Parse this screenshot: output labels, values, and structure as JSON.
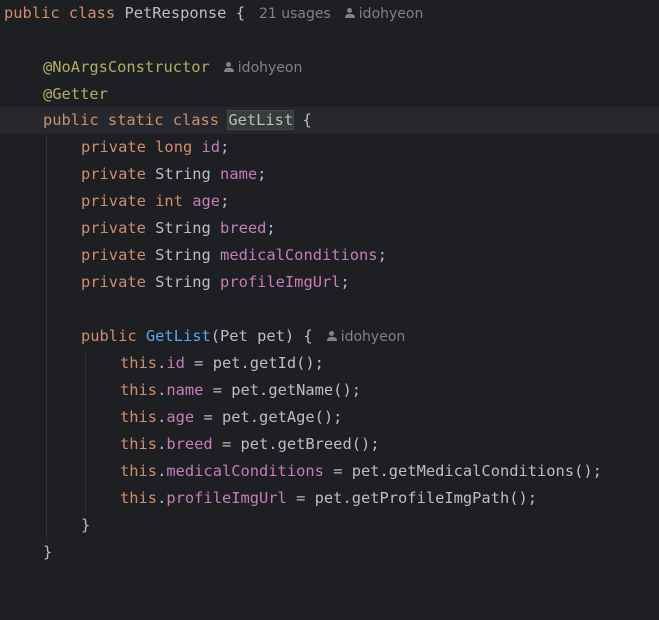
{
  "code": {
    "outer_class": {
      "modifiers": "public class",
      "name": "PetResponse",
      "brace": "{",
      "usages_hint": "21 usages",
      "author": "idohyeon"
    },
    "annotations": {
      "no_args": "@NoArgsConstructor",
      "no_args_author": "idohyeon",
      "getter": "@Getter"
    },
    "inner_class": {
      "modifiers": "public static class",
      "name": "GetList",
      "brace": "{"
    },
    "fields": [
      {
        "modifier": "private",
        "type": "long",
        "name": "id",
        "type_is_keyword": true
      },
      {
        "modifier": "private",
        "type": "String",
        "name": "name",
        "type_is_keyword": false
      },
      {
        "modifier": "private",
        "type": "int",
        "name": "age",
        "type_is_keyword": true
      },
      {
        "modifier": "private",
        "type": "String",
        "name": "breed",
        "type_is_keyword": false
      },
      {
        "modifier": "private",
        "type": "String",
        "name": "medicalConditions",
        "type_is_keyword": false
      },
      {
        "modifier": "private",
        "type": "String",
        "name": "profileImgUrl",
        "type_is_keyword": false
      }
    ],
    "constructor": {
      "modifier": "public",
      "name": "GetList",
      "params": "(Pet pet) {",
      "author": "idohyeon"
    },
    "assignments": [
      {
        "field": "id",
        "call": "pet.getId();"
      },
      {
        "field": "name",
        "call": "pet.getName();"
      },
      {
        "field": "age",
        "call": "pet.getAge();"
      },
      {
        "field": "breed",
        "call": "pet.getBreed();"
      },
      {
        "field": "medicalConditions",
        "call": "pet.getMedicalConditions();"
      },
      {
        "field": "profileImgUrl",
        "call": "pet.getProfileImgPath();"
      }
    ],
    "this_keyword": "this",
    "close_brace": "}"
  },
  "colors": {
    "background": "#1e1f22",
    "keyword": "#cf8e6d",
    "annotation": "#b3ae60",
    "field": "#c77dbb",
    "method": "#56a8f5",
    "text": "#bcbec4",
    "hint": "#7f8289"
  }
}
